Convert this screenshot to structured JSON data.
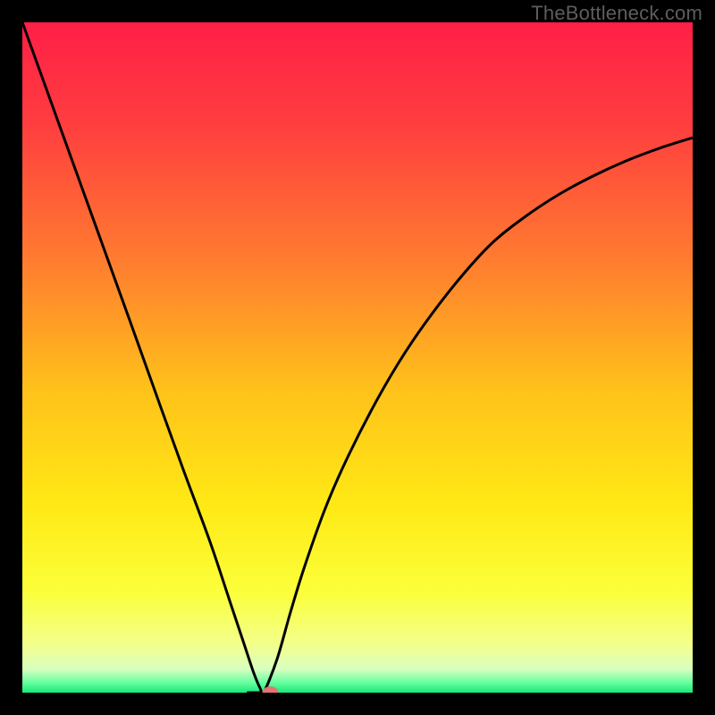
{
  "watermark": "TheBottleneck.com",
  "chart_data": {
    "type": "line",
    "title": "",
    "xlabel": "",
    "ylabel": "",
    "xlim": [
      0,
      100
    ],
    "ylim": [
      0,
      100
    ],
    "gradient_stops": [
      {
        "offset": 0.0,
        "color": "#ff1f47"
      },
      {
        "offset": 0.15,
        "color": "#ff3d3f"
      },
      {
        "offset": 0.35,
        "color": "#ff7a30"
      },
      {
        "offset": 0.55,
        "color": "#ffc21a"
      },
      {
        "offset": 0.72,
        "color": "#ffe915"
      },
      {
        "offset": 0.85,
        "color": "#fbff3a"
      },
      {
        "offset": 0.93,
        "color": "#f3ff8e"
      },
      {
        "offset": 0.965,
        "color": "#d8ffc0"
      },
      {
        "offset": 0.985,
        "color": "#66ff9e"
      },
      {
        "offset": 1.0,
        "color": "#19e87a"
      }
    ],
    "series": [
      {
        "name": "bottleneck-curve",
        "x": [
          0.0,
          4.0,
          8.0,
          12.0,
          16.0,
          20.0,
          24.0,
          28.0,
          31.0,
          33.0,
          34.5,
          35.5,
          36.0,
          38.0,
          40.0,
          42.0,
          45.0,
          48.0,
          52.0,
          56.0,
          60.0,
          65.0,
          70.0,
          75.0,
          80.0,
          85.0,
          90.0,
          95.0,
          100.0
        ],
        "y": [
          100.0,
          88.9,
          77.8,
          66.7,
          55.6,
          44.4,
          33.3,
          22.5,
          13.5,
          7.5,
          3.0,
          0.6,
          0.0,
          5.0,
          12.0,
          18.5,
          27.0,
          34.0,
          42.0,
          49.0,
          55.0,
          61.5,
          67.0,
          71.0,
          74.3,
          77.0,
          79.3,
          81.2,
          82.8
        ]
      }
    ],
    "marker": {
      "x": 37.0,
      "y": 0.0,
      "color": "#e57373",
      "rx": 9,
      "ry": 7
    },
    "flat_segment": {
      "x0": 33.5,
      "x1": 36.0,
      "y": 0.0
    }
  }
}
